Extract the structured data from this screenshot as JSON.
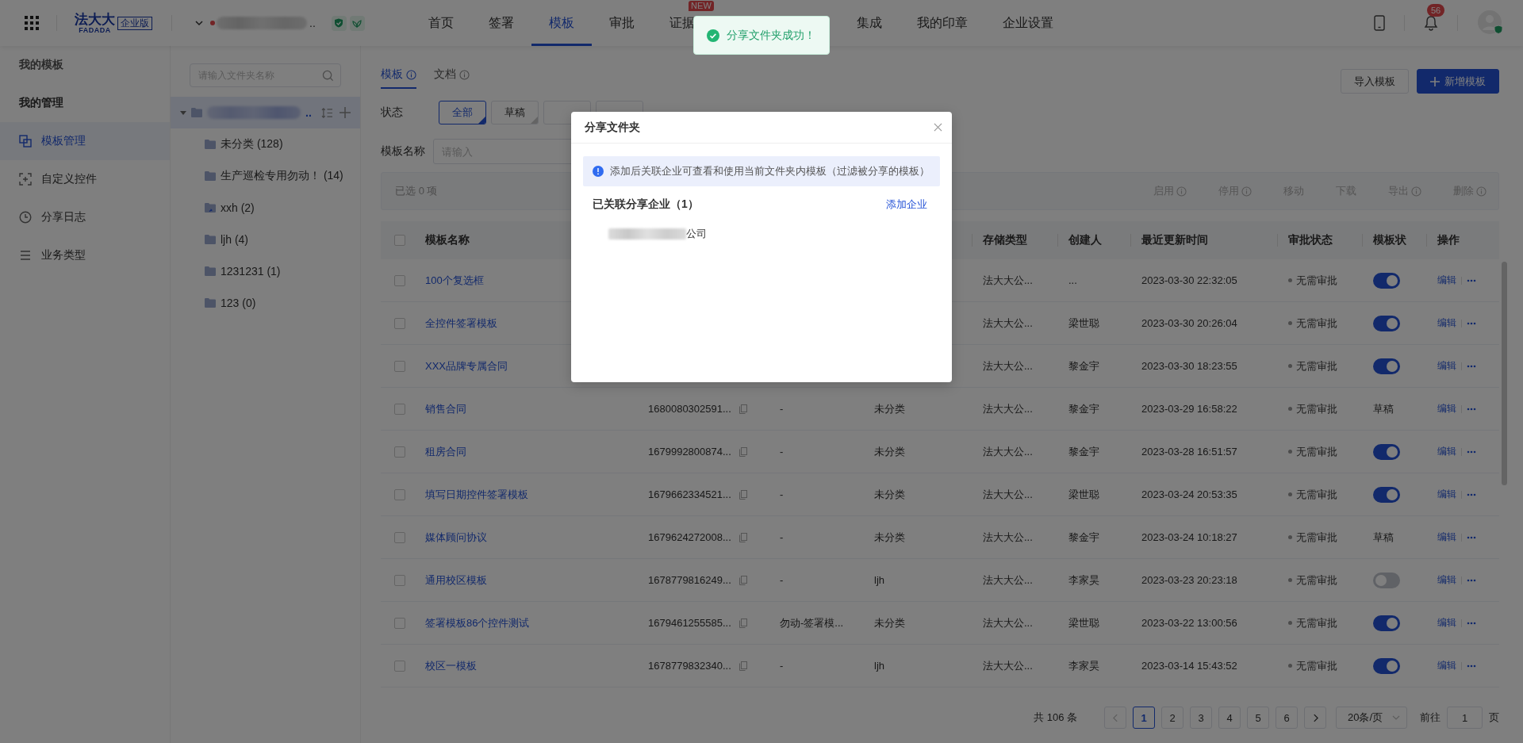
{
  "top_bar": {
    "logo_text": "法大大",
    "logo_latin": "FADADA",
    "edition": "企业版",
    "company_ellipsis": "..",
    "nav": [
      {
        "label": "首页",
        "selected": false
      },
      {
        "label": "签署",
        "selected": false
      },
      {
        "label": "模板",
        "selected": true
      },
      {
        "label": "审批",
        "selected": false
      },
      {
        "label": "证据",
        "selected": false,
        "badge": "NEW"
      },
      {
        "label": "集成",
        "selected": false
      },
      {
        "label": "我的印章",
        "selected": false
      },
      {
        "label": "企业设置",
        "selected": false
      }
    ],
    "notification_count": "56"
  },
  "toast": {
    "message": "分享文件夹成功！"
  },
  "sidebar": {
    "groups": [
      {
        "title": "我的模板"
      },
      {
        "title": "我的管理",
        "items": [
          {
            "label": "模板管理",
            "kind": "templates",
            "selected": true
          },
          {
            "label": "自定义控件",
            "kind": "controls",
            "selected": false
          },
          {
            "label": "分享日志",
            "kind": "history",
            "selected": false
          },
          {
            "label": "业务类型",
            "kind": "types",
            "selected": false
          }
        ]
      }
    ]
  },
  "folder_panel": {
    "search_placeholder": "请输入文件夹名称",
    "root": {
      "name_ellipsis": "..",
      "expanded": true,
      "selected": true,
      "children": [
        {
          "label": "未分类 (128)",
          "kind": "folder",
          "selected": false
        },
        {
          "label": "生产巡检专用勿动！ (14)",
          "kind": "folder",
          "selected": false
        },
        {
          "label": "xxh (2)",
          "kind": "shared",
          "selected": false
        },
        {
          "label": "ljh (4)",
          "kind": "folder",
          "selected": false
        },
        {
          "label": "1231231 (1)",
          "kind": "folder",
          "selected": false
        },
        {
          "label": "123 (0)",
          "kind": "folder",
          "selected": false
        }
      ]
    }
  },
  "content": {
    "tabs": [
      {
        "label": "模板",
        "selected": true,
        "info": true
      },
      {
        "label": "文档",
        "selected": false,
        "info": true
      }
    ],
    "import_button": "导入模板",
    "new_button": "新增模板",
    "status_filter": {
      "label": "状态",
      "options": [
        {
          "label": "全部",
          "selected": true
        },
        {
          "label": "草稿",
          "selected": false
        },
        {
          "selected": false
        },
        {
          "selected": false
        }
      ]
    },
    "name_filter": {
      "label": "模板名称",
      "placeholder": "请输入"
    },
    "selection": {
      "prefix": "已选",
      "count": "0",
      "suffix": "项",
      "actions": [
        {
          "label": "启用",
          "info": true,
          "disabled": true
        },
        {
          "label": "停用",
          "info": true,
          "disabled": true
        },
        {
          "label": "移动",
          "info": false,
          "disabled": true
        },
        {
          "label": "下载",
          "info": false,
          "disabled": true
        },
        {
          "label": "导出",
          "info": true,
          "disabled": true
        },
        {
          "label": "删除",
          "info": true,
          "disabled": true
        }
      ]
    },
    "table": {
      "select_all_checked": false,
      "columns": {
        "name": "模板名称",
        "storage": "存储类型",
        "creator": "创建人",
        "updated": "最近更新时间",
        "approval": "审批状态",
        "status": "模板状",
        "actions": "操作"
      },
      "rows": [
        {
          "checked": false,
          "name": "100个复选框",
          "storage": "法大大公...",
          "creator": "...",
          "updated": "2023-03-30 22:32:05",
          "approval": "无需审批",
          "status": {
            "kind": "toggle",
            "on": true
          },
          "edit": "编辑"
        },
        {
          "checked": false,
          "name": "全控件签署模板",
          "storage": "法大大公...",
          "creator": "梁世聪",
          "updated": "2023-03-30 20:26:04",
          "approval": "无需审批",
          "status": {
            "kind": "toggle",
            "on": true
          },
          "edit": "编辑"
        },
        {
          "checked": false,
          "name": "XXX品牌专属合同",
          "storage": "法大大公...",
          "creator": "黎金宇",
          "updated": "2023-03-30 18:23:55",
          "approval": "无需审批",
          "status": {
            "kind": "toggle",
            "on": true
          },
          "edit": "编辑"
        },
        {
          "checked": false,
          "name": "销售合同",
          "id": "1680080302591...",
          "business": "-",
          "folder": "未分类",
          "storage": "法大大公...",
          "creator": "黎金宇",
          "updated": "2023-03-29 16:58:22",
          "approval": "无需审批",
          "status": {
            "kind": "text",
            "label": "草稿"
          },
          "edit": "编辑"
        },
        {
          "checked": false,
          "name": "租房合同",
          "id": "1679992800874...",
          "business": "-",
          "folder": "未分类",
          "storage": "法大大公...",
          "creator": "黎金宇",
          "updated": "2023-03-28 16:51:57",
          "approval": "无需审批",
          "status": {
            "kind": "toggle",
            "on": true
          },
          "edit": "编辑"
        },
        {
          "checked": false,
          "name": "填写日期控件签署模板",
          "id": "1679662334521...",
          "business": "-",
          "folder": "未分类",
          "storage": "法大大公...",
          "creator": "梁世聪",
          "updated": "2023-03-24 20:53:35",
          "approval": "无需审批",
          "status": {
            "kind": "toggle",
            "on": true
          },
          "edit": "编辑"
        },
        {
          "checked": false,
          "name": "媒体顾问协议",
          "id": "1679624272008...",
          "business": "-",
          "folder": "未分类",
          "storage": "法大大公...",
          "creator": "黎金宇",
          "updated": "2023-03-24 10:18:27",
          "approval": "无需审批",
          "status": {
            "kind": "text",
            "label": "草稿"
          },
          "edit": "编辑"
        },
        {
          "checked": false,
          "name": "通用校区模板",
          "id": "1678779816249...",
          "business": "-",
          "folder": "ljh",
          "storage": "法大大公...",
          "creator": "李家昊",
          "updated": "2023-03-23 20:23:18",
          "approval": "无需审批",
          "status": {
            "kind": "toggle",
            "on": false
          },
          "edit": "编辑"
        },
        {
          "checked": false,
          "name": "签署模板86个控件测试",
          "id": "1679461255585...",
          "business": "勿动-签署模...",
          "folder": "未分类",
          "storage": "法大大公...",
          "creator": "梁世聪",
          "updated": "2023-03-22 13:00:56",
          "approval": "无需审批",
          "status": {
            "kind": "toggle",
            "on": true
          },
          "edit": "编辑"
        },
        {
          "checked": false,
          "name": "校区一模板",
          "id": "1678779832340...",
          "business": "-",
          "folder": "ljh",
          "storage": "法大大公...",
          "creator": "李家昊",
          "updated": "2023-03-14 15:43:52",
          "approval": "无需审批",
          "status": {
            "kind": "toggle",
            "on": true
          },
          "edit": "编辑"
        }
      ]
    },
    "pagination": {
      "total": "共 106 条",
      "pages": [
        {
          "label": "1",
          "selected": true
        },
        {
          "label": "2",
          "selected": false
        },
        {
          "label": "3",
          "selected": false
        },
        {
          "label": "4",
          "selected": false
        },
        {
          "label": "5",
          "selected": false
        },
        {
          "label": "6",
          "selected": false
        }
      ],
      "page_size": "20条/页",
      "goto_label": "前往",
      "goto_value": "1",
      "goto_suffix": "页"
    }
  },
  "modal": {
    "title": "分享文件夹",
    "notice": "添加后关联企业可查看和使用当前文件夹内模板（过滤被分享的模板）",
    "section_title": "已关联分享企业（1）",
    "add_link": "添加企业",
    "companies": [
      {
        "name_suffix": "公司"
      }
    ]
  }
}
